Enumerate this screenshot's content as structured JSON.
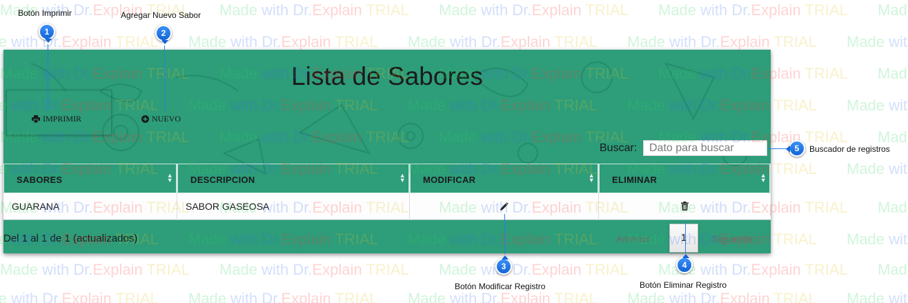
{
  "watermark": {
    "made": "Made",
    "with": "with",
    "brand_a": "Dr.",
    "brand_b": "Explain",
    "trial": "TRIAL"
  },
  "callouts": [
    {
      "number": "1",
      "label": "Botón Imprimir"
    },
    {
      "number": "2",
      "label": "Agregar Nuevo Sabor"
    },
    {
      "number": "3",
      "label": "Botón Modificar Registro"
    },
    {
      "number": "4",
      "label": "Botón Eliminar Registro"
    },
    {
      "number": "5",
      "label": "Buscador de registros"
    }
  ],
  "page": {
    "title": "Lista de Sabores",
    "accent_color": "#2d9d7a"
  },
  "toolbar": {
    "print_icon": "printer-icon",
    "print_label": "IMPRIMIR",
    "new_icon": "plus-circle-icon",
    "new_label": "NUEVO"
  },
  "search": {
    "label": "Buscar:",
    "placeholder": "Dato para buscar",
    "value": ""
  },
  "table": {
    "columns": [
      "SABORES",
      "DESCRIPCION",
      "MODIFICAR",
      "ELIMINAR"
    ],
    "rows": [
      {
        "sabor": "GUARANA",
        "descripcion": "SABOR GASEOSA",
        "edit_icon": "pencil-icon",
        "delete_icon": "trash-icon"
      }
    ]
  },
  "footer": {
    "info": "Del 1 al 1 de 1 (actualizados)",
    "prev_label": "Anterior",
    "current_page": "1",
    "next_label": "Siguiente"
  }
}
